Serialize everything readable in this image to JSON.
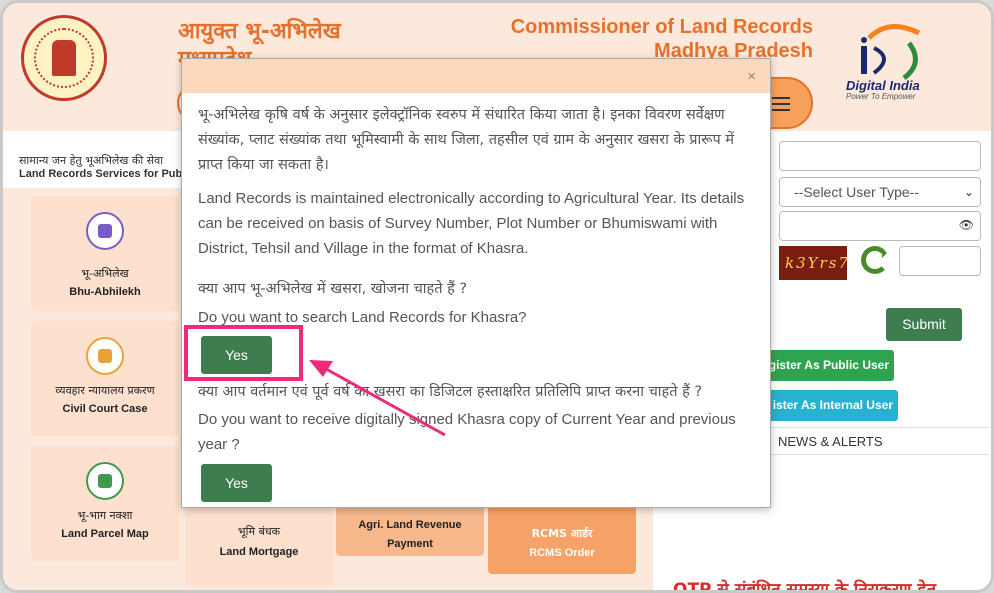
{
  "header": {
    "title_hi_line1": "आयुक्त भू-अभिलेख",
    "title_hi_line2": "मध्यप्रदेश",
    "title_en_line1": "Commissioner of Land Records",
    "title_en_line2": "Madhya Pradesh",
    "digital_india": "Digital India",
    "digital_india_tagline": "Power To Empower"
  },
  "services": {
    "heading_hi": "सामान्य जन हेतु भूअभिलेख की सेवा",
    "heading_en": "Land Records Services for Public",
    "tiles": [
      {
        "hi": "भू-अभिलेख",
        "en": "Bhu-Abhilekh",
        "icon": "home-icon"
      },
      {
        "hi": "व्यवहार न्यायालय प्रकरण",
        "en": "Civil Court Case",
        "icon": "building-icon"
      },
      {
        "hi": "भू-भाग नक्शा",
        "en": "Land Parcel Map",
        "icon": "map-icon"
      },
      {
        "hi": "भूमि बंधक",
        "en": "Land Mortgage",
        "icon": "mortgage-icon"
      },
      {
        "hi": "Agri. Land Revenue",
        "en": "Payment",
        "icon": "payment-icon"
      },
      {
        "hi": "RCMS आर्डर",
        "en": "RCMS Order",
        "icon": "order-icon"
      }
    ]
  },
  "login": {
    "select_user_type": "--Select User Type--",
    "captcha_text": "k3Yrs7",
    "submit_label": "Submit",
    "register_public": "gister As Public User",
    "register_internal": "ister As Internal User",
    "news_alerts": "NEWS & ALERTS",
    "otp_text": "OTP से संबंधित समस्या के निराकरण हेतु"
  },
  "modal": {
    "close": "×",
    "intro_hi": "भू-अभिलेख कृषि वर्ष के अनुसार इलेक्ट्रॉनिक स्वरुप में संधारित किया जाता है। इनका विवरण सर्वेक्षण संख्यांक, प्लाट संख्यांक तथा भूमिस्वामी के साथ जिला, तहसील एवं ग्राम के अनुसार खसरा के प्रारूप में प्राप्त किया जा सकता है।",
    "intro_en": "Land Records is maintained electronically according to Agricultural Year. Its details can be received on basis of Survey Number, Plot Number or Bhumiswami with District, Tehsil and Village in the format of Khasra.",
    "q1_hi": "क्या आप भू-अभिलेख में खसरा, खोजना चाहते हैं ?",
    "q1_en": "Do you want to search Land Records for Khasra?",
    "yes1": "Yes",
    "q2_hi": "क्या आप वर्तमान एवं पूर्व वर्ष का खसरा का डिजिटल हस्ताक्षरित प्रतिलिपि प्राप्त करना चाहते हैं ?",
    "q2_en": "Do you want to receive digitally signed Khasra copy of Current Year and previous year ?",
    "yes2": "Yes"
  },
  "colors": {
    "accent_orange": "#e8702a",
    "button_green": "#3e7d4e",
    "highlight_pink": "#ee2a7b"
  }
}
